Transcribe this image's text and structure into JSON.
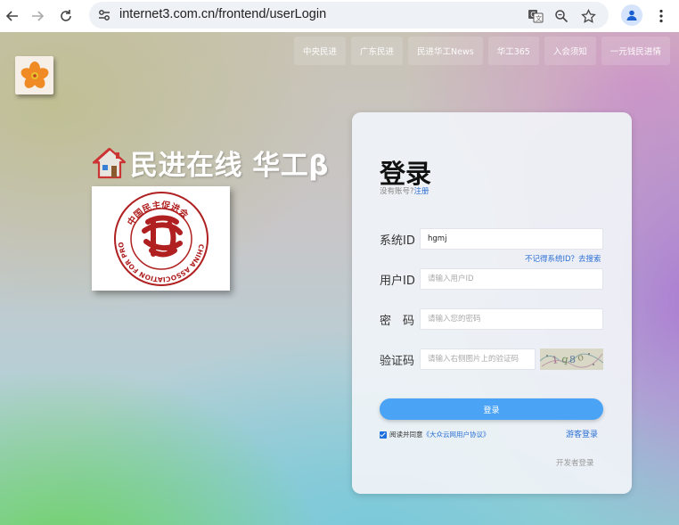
{
  "browser": {
    "url": "internet3.com.cn/frontend/userLogin"
  },
  "colors": {
    "accent": "#4aa3f5",
    "link": "#2a6fd6"
  },
  "topnav": [
    {
      "label": "中央民进"
    },
    {
      "label": "广东民进"
    },
    {
      "label": "民进华工News"
    },
    {
      "label": "华工365"
    },
    {
      "label": "入会须知"
    },
    {
      "label": "一元钱民进情"
    }
  ],
  "brand": {
    "title": "民进在线 华工β",
    "emblem_top_text": "中国民主促进会",
    "emblem_ring_text": "CHINA ASSOCIATION FOR PROMOTING DEMOCRACY"
  },
  "login": {
    "title": "登录",
    "no_account": "没有账号?",
    "register": "注册",
    "system_id_label": "系统ID",
    "system_id_value": "hgmj",
    "forgot_system_id": "不记得系统ID？去搜索",
    "user_id_label": "用户ID",
    "user_id_placeholder": "请输入用户ID",
    "password_label": "密　码",
    "password_placeholder": "请输入您的密码",
    "captcha_label": "验证码",
    "captcha_placeholder": "请输入右侧图片上的验证码",
    "login_button": "登录",
    "agree_prefix": "阅读并同意",
    "agree_link": "《大众云网用户协议》",
    "guest_login": "游客登录",
    "developer_login": "开发者登录"
  }
}
